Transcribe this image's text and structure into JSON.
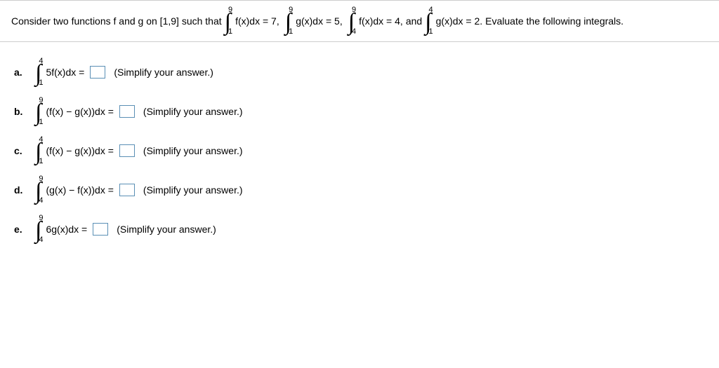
{
  "problem": {
    "intro": "Consider two functions f and g on [1,9] such that",
    "given": [
      {
        "upper": "9",
        "lower": "1",
        "expr": "f(x)dx = 7,"
      },
      {
        "upper": "9",
        "lower": "1",
        "expr": "g(x)dx = 5,"
      },
      {
        "upper": "9",
        "lower": "4",
        "expr": "f(x)dx = 4,"
      },
      {
        "upper": "4",
        "lower": "1",
        "expr": "g(x)dx = 2."
      }
    ],
    "and": " and ",
    "outro": " Evaluate the following integrals."
  },
  "parts": [
    {
      "label": "a.",
      "upper": "4",
      "lower": "1",
      "expr": "5f(x)dx =",
      "hint": "(Simplify your answer.)"
    },
    {
      "label": "b.",
      "upper": "9",
      "lower": "1",
      "expr": "(f(x) − g(x))dx =",
      "hint": "(Simplify your answer.)"
    },
    {
      "label": "c.",
      "upper": "4",
      "lower": "1",
      "expr": "(f(x) − g(x))dx =",
      "hint": "(Simplify your answer.)"
    },
    {
      "label": "d.",
      "upper": "9",
      "lower": "4",
      "expr": "(g(x) − f(x))dx =",
      "hint": "(Simplify your answer.)"
    },
    {
      "label": "e.",
      "upper": "9",
      "lower": "4",
      "expr": "6g(x)dx =",
      "hint": "(Simplify your answer.)"
    }
  ]
}
